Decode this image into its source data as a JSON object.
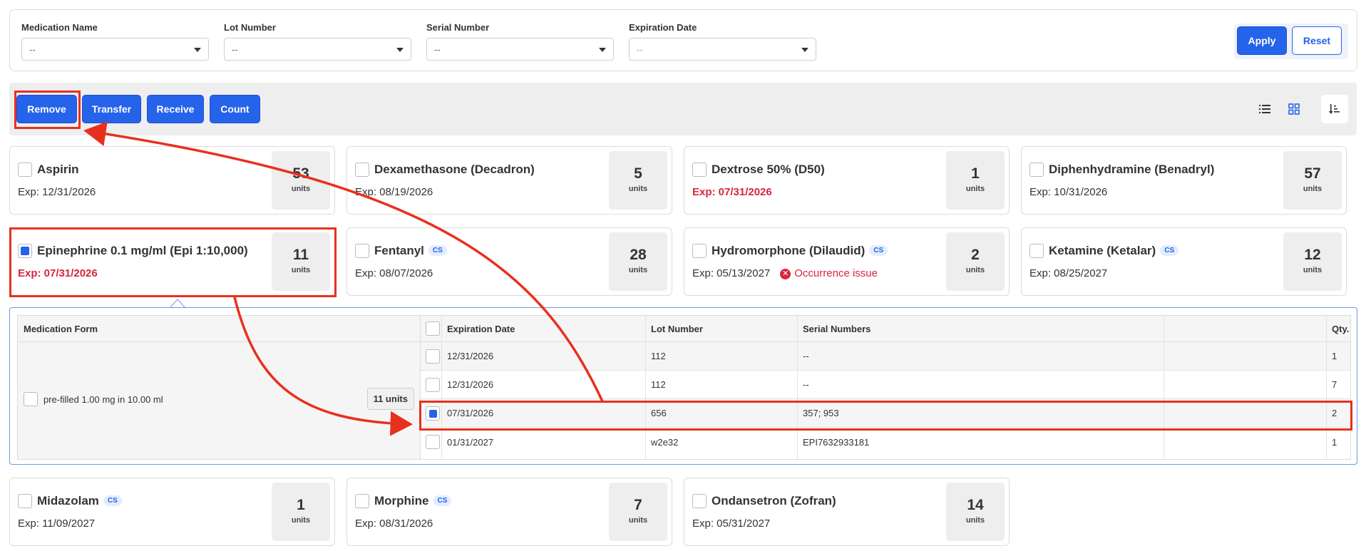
{
  "filters": {
    "medication_name": {
      "label": "Medication Name",
      "value": "--"
    },
    "lot_number": {
      "label": "Lot Number",
      "value": "--"
    },
    "serial_number": {
      "label": "Serial Number",
      "value": "--"
    },
    "expiration_date": {
      "label": "Expiration Date",
      "value": "--"
    },
    "apply_label": "Apply",
    "reset_label": "Reset"
  },
  "toolbar": {
    "remove_label": "Remove",
    "transfer_label": "Transfer",
    "receive_label": "Receive",
    "count_label": "Count",
    "icons": [
      "list-view-icon",
      "grid-view-icon",
      "sort-icon"
    ]
  },
  "cards": [
    {
      "name": "Aspirin",
      "exp": "Exp: 12/31/2026",
      "qty": "53",
      "unit": "units",
      "cs": false,
      "checked": false,
      "exp_red": false
    },
    {
      "name": "Dexamethasone (Decadron)",
      "exp": "Exp: 08/19/2026",
      "qty": "5",
      "unit": "units",
      "cs": false,
      "checked": false,
      "exp_red": false
    },
    {
      "name": "Dextrose 50% (D50)",
      "exp": "Exp: 07/31/2026",
      "qty": "1",
      "unit": "units",
      "cs": false,
      "checked": false,
      "exp_red": true
    },
    {
      "name": "Diphenhydramine (Benadryl)",
      "exp": "Exp: 10/31/2026",
      "qty": "57",
      "unit": "units",
      "cs": false,
      "checked": false,
      "exp_red": false
    },
    {
      "name": "Epinephrine 0.1 mg/ml (Epi 1:10,000)",
      "exp": "Exp: 07/31/2026",
      "qty": "11",
      "unit": "units",
      "cs": false,
      "checked": true,
      "exp_red": true
    },
    {
      "name": "Fentanyl",
      "exp": "Exp: 08/07/2026",
      "qty": "28",
      "unit": "units",
      "cs": true,
      "checked": false,
      "exp_red": false
    },
    {
      "name": "Hydromorphone (Dilaudid)",
      "exp": "Exp: 05/13/2027",
      "qty": "2",
      "unit": "units",
      "cs": true,
      "checked": false,
      "exp_red": false,
      "issue": "Occurrence issue"
    },
    {
      "name": "Ketamine (Ketalar)",
      "exp": "Exp: 08/25/2027",
      "qty": "12",
      "unit": "units",
      "cs": true,
      "checked": false,
      "exp_red": false
    },
    {
      "name": "Midazolam",
      "exp": "Exp: 11/09/2027",
      "qty": "1",
      "unit": "units",
      "cs": true,
      "checked": false,
      "exp_red": false
    },
    {
      "name": "Morphine",
      "exp": "Exp: 08/31/2026",
      "qty": "7",
      "unit": "units",
      "cs": true,
      "checked": false,
      "exp_red": false
    },
    {
      "name": "Ondansetron (Zofran)",
      "exp": "Exp: 05/31/2027",
      "qty": "14",
      "unit": "units",
      "cs": false,
      "checked": false,
      "exp_red": false
    }
  ],
  "cs_badge": "CS",
  "detail": {
    "form_header": "Medication Form",
    "form_label": "pre-filled 1.00 mg in 10.00 ml",
    "form_units": "11 units",
    "columns": [
      "Expiration Date",
      "Lot Number",
      "Serial Numbers",
      "",
      "Qty."
    ],
    "rows": [
      {
        "exp": "12/31/2026",
        "lot": "112",
        "serial": "--",
        "qty": "1",
        "checked": false
      },
      {
        "exp": "12/31/2026",
        "lot": "112",
        "serial": "--",
        "qty": "7",
        "checked": false
      },
      {
        "exp": "07/31/2026",
        "lot": "656",
        "serial": "357; 953",
        "qty": "2",
        "checked": true
      },
      {
        "exp": "01/31/2027",
        "lot": "w2e32",
        "serial": "EPI7632933181",
        "qty": "1",
        "checked": false
      }
    ]
  },
  "colors": {
    "accent": "#2563eb",
    "annotation": "#e8301e",
    "danger": "#d7263d"
  }
}
